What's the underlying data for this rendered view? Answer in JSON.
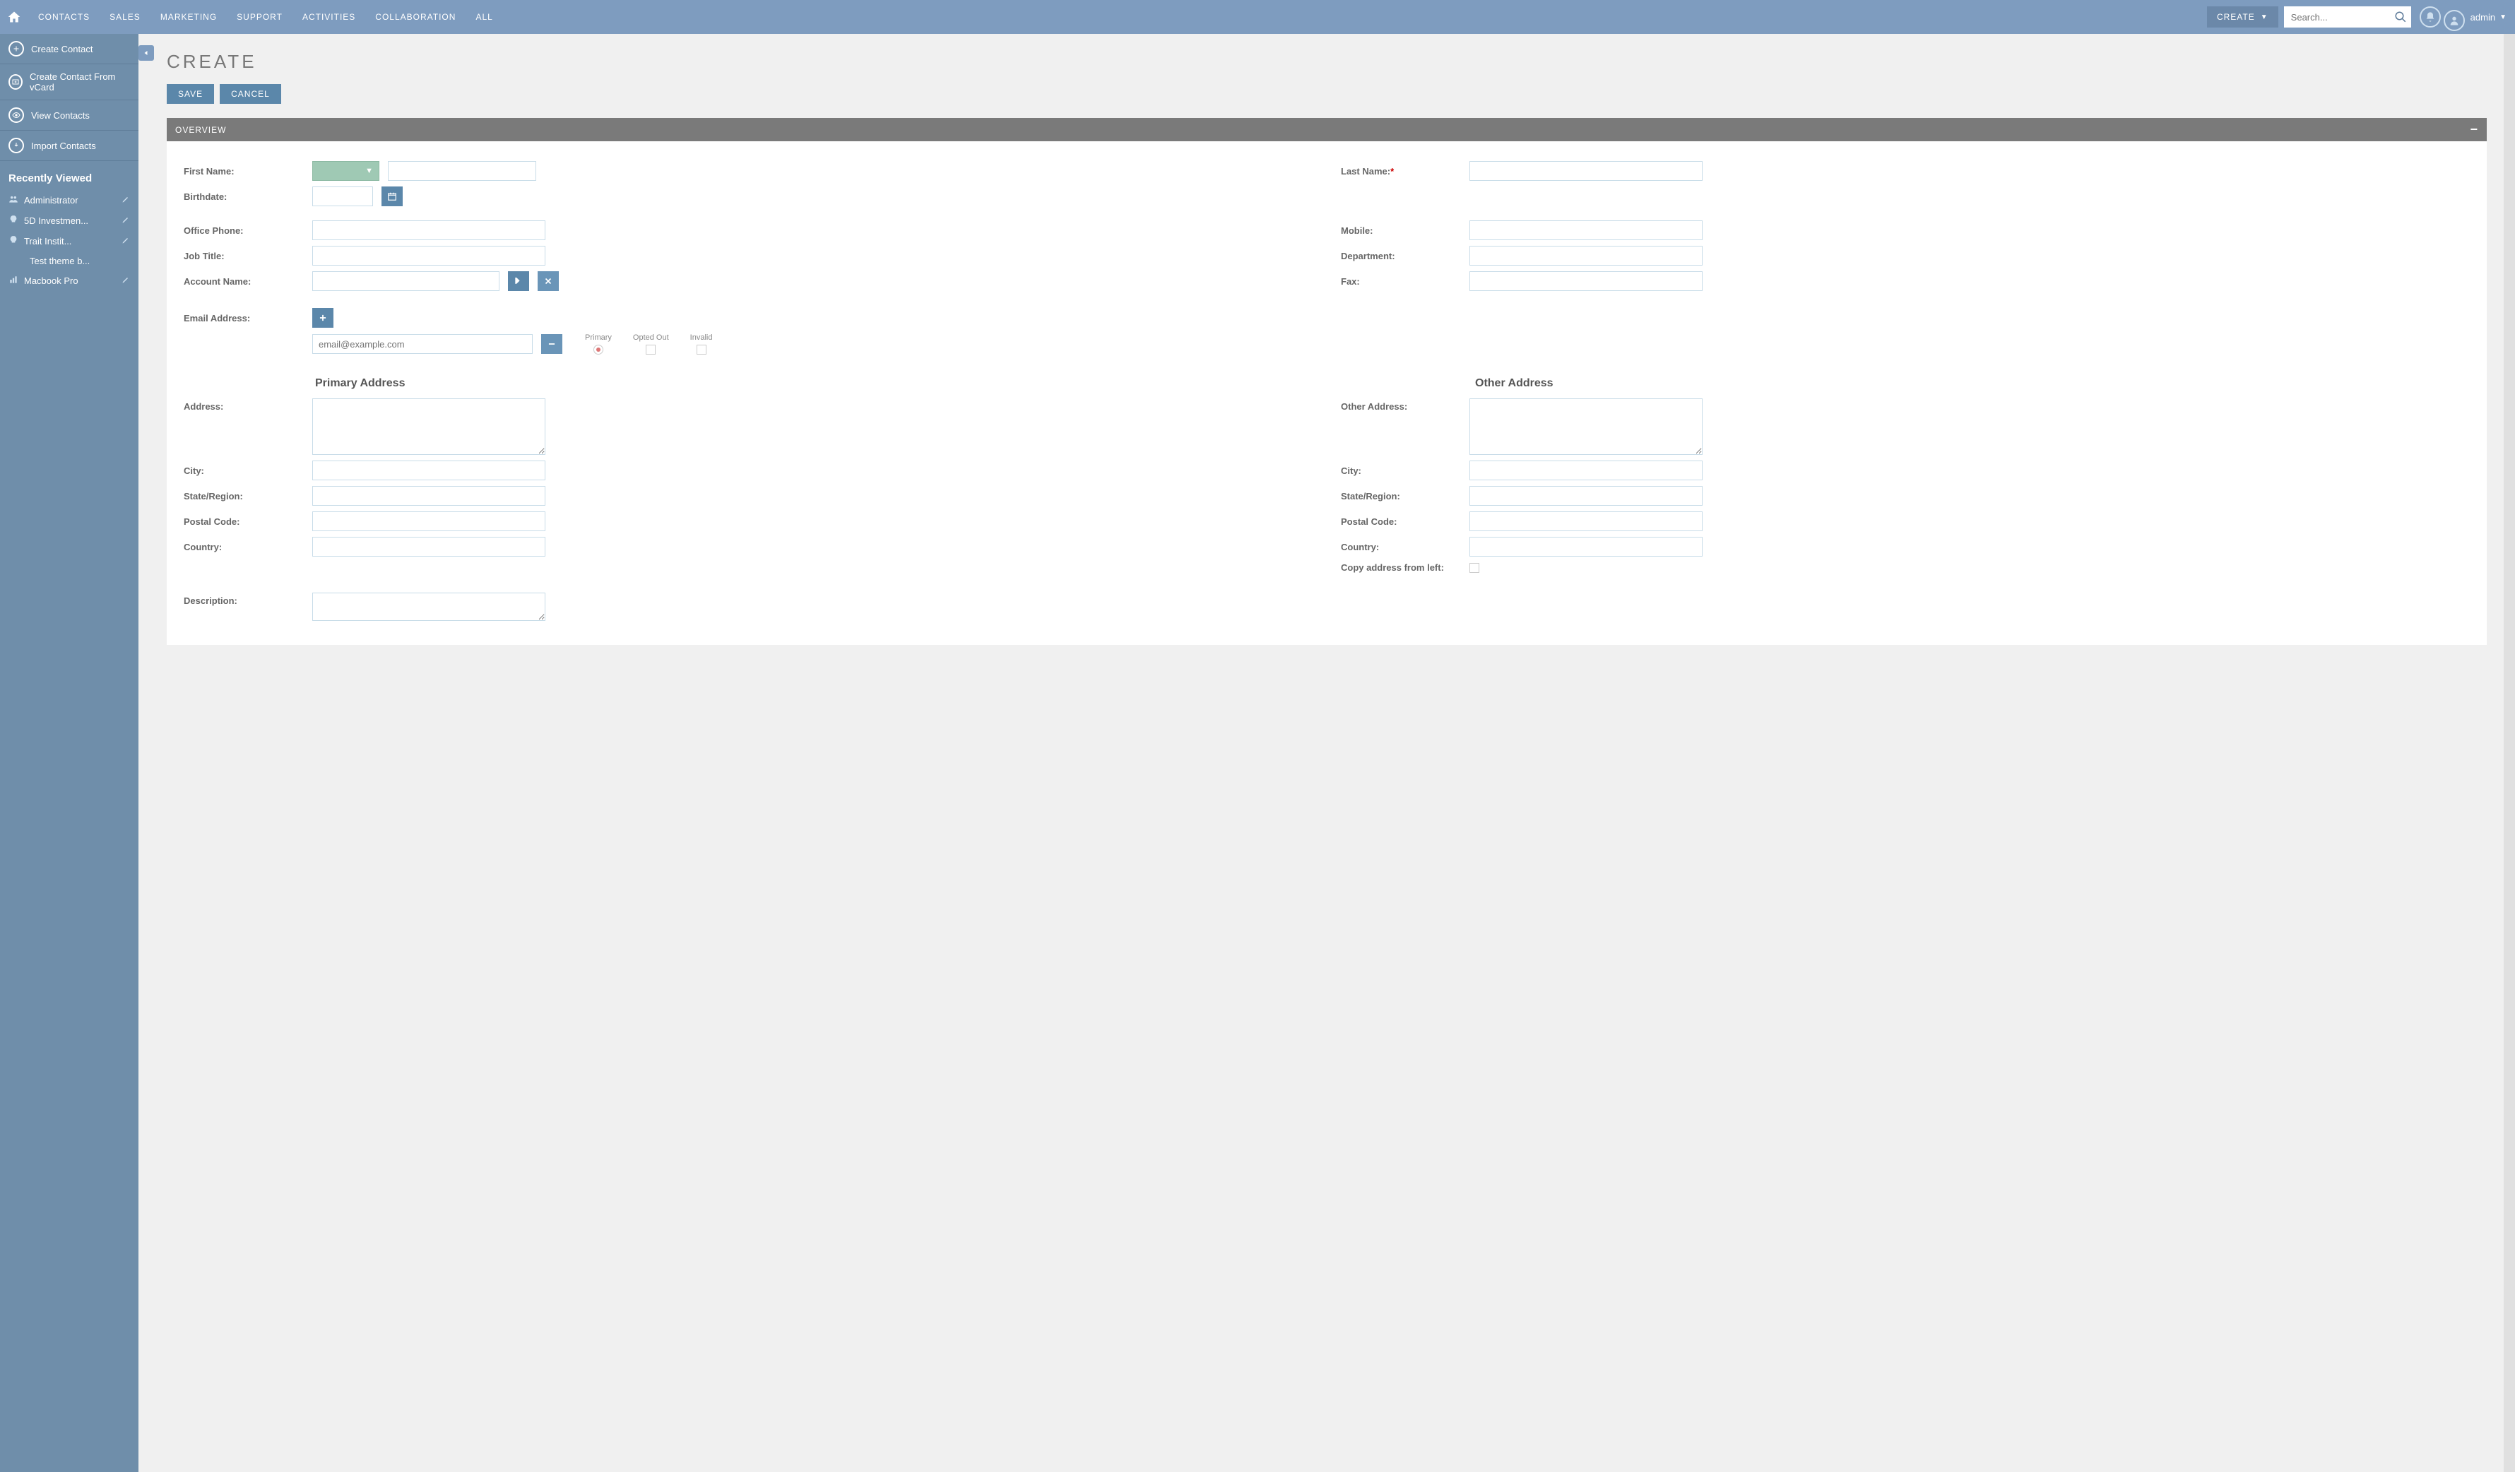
{
  "nav": {
    "tabs": [
      "CONTACTS",
      "SALES",
      "MARKETING",
      "SUPPORT",
      "ACTIVITIES",
      "COLLABORATION",
      "ALL"
    ],
    "create_btn": "CREATE",
    "search_placeholder": "Search...",
    "user": "admin"
  },
  "sidebar": {
    "actions": [
      {
        "label": "Create Contact",
        "icon": "plus"
      },
      {
        "label": "Create Contact From vCard",
        "icon": "vcard"
      },
      {
        "label": "View Contacts",
        "icon": "eye"
      },
      {
        "label": "Import Contacts",
        "icon": "download"
      }
    ],
    "recent_header": "Recently Viewed",
    "recent": [
      {
        "label": "Administrator",
        "icon": "people",
        "edit": true
      },
      {
        "label": "5D Investmen...",
        "icon": "bulb",
        "edit": true
      },
      {
        "label": "Trait Instit...",
        "icon": "bulb",
        "edit": true
      },
      {
        "label": "Test theme b...",
        "icon": "",
        "edit": false
      },
      {
        "label": "Macbook Pro",
        "icon": "chart",
        "edit": true
      }
    ]
  },
  "page": {
    "title": "CREATE",
    "save": "SAVE",
    "cancel": "CANCEL",
    "section": "OVERVIEW"
  },
  "form": {
    "first_name": "First Name:",
    "last_name": "Last Name:",
    "birthdate": "Birthdate:",
    "office_phone": "Office Phone:",
    "mobile": "Mobile:",
    "job_title": "Job Title:",
    "department": "Department:",
    "account_name": "Account Name:",
    "fax": "Fax:",
    "email": "Email Address:",
    "email_placeholder": "email@example.com",
    "email_primary": "Primary",
    "email_optout": "Opted Out",
    "email_invalid": "Invalid",
    "primary_addr": "Primary Address",
    "other_addr": "Other Address",
    "address": "Address:",
    "other_address": "Other Address:",
    "city": "City:",
    "state": "State/Region:",
    "postal": "Postal Code:",
    "country": "Country:",
    "copy_addr": "Copy address from left:",
    "description": "Description:"
  }
}
